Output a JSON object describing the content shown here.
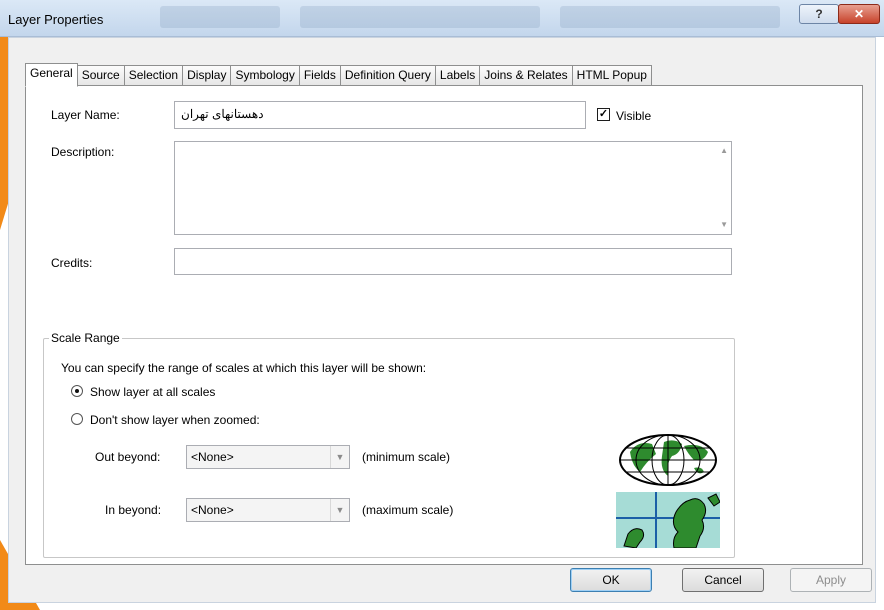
{
  "window": {
    "title": "Layer Properties"
  },
  "tabs": [
    {
      "label": "General"
    },
    {
      "label": "Source"
    },
    {
      "label": "Selection"
    },
    {
      "label": "Display"
    },
    {
      "label": "Symbology"
    },
    {
      "label": "Fields"
    },
    {
      "label": "Definition Query"
    },
    {
      "label": "Labels"
    },
    {
      "label": "Joins & Relates"
    },
    {
      "label": "HTML Popup"
    }
  ],
  "general": {
    "layer_name_label": "Layer Name:",
    "layer_name_value": "دهستانهای تهران",
    "visible_label": "Visible",
    "visible_checked": true,
    "description_label": "Description:",
    "description_value": "",
    "credits_label": "Credits:",
    "credits_value": ""
  },
  "scale_range": {
    "legend": "Scale Range",
    "intro": "You can specify the range of scales at which this layer will be shown:",
    "option_all": "Show layer at all scales",
    "option_zoomed": "Don't show layer when zoomed:",
    "selected": "all",
    "out_label": "Out beyond:",
    "out_value": "<None>",
    "out_hint": "(minimum scale)",
    "in_label": "In beyond:",
    "in_value": "<None>",
    "in_hint": "(maximum scale)"
  },
  "buttons": {
    "ok": "OK",
    "cancel": "Cancel",
    "apply": "Apply"
  },
  "colors": {
    "accent_orange": "#f28a18",
    "panel_bg": "#f0f0f0"
  }
}
